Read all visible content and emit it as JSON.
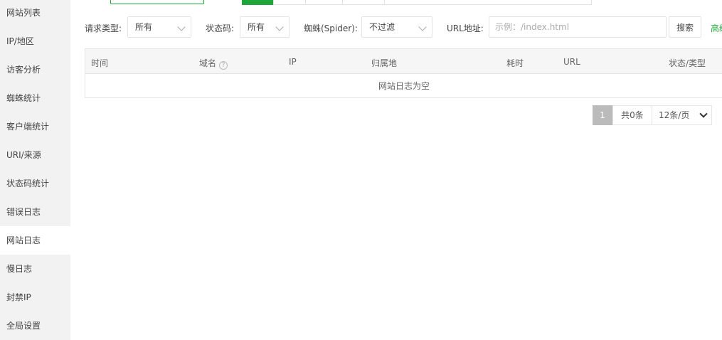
{
  "sidebar": {
    "items": [
      {
        "label": "网站列表"
      },
      {
        "label": "IP/地区"
      },
      {
        "label": "访客分析"
      },
      {
        "label": "蜘蛛统计"
      },
      {
        "label": "客户端统计"
      },
      {
        "label": "URI/来源"
      },
      {
        "label": "状态码统计"
      },
      {
        "label": "错误日志"
      },
      {
        "label": "网站日志",
        "active": true
      },
      {
        "label": "慢日志"
      },
      {
        "label": "封禁IP"
      },
      {
        "label": "全局设置"
      }
    ]
  },
  "filters": {
    "request_type_label": "请求类型:",
    "request_type_value": "所有",
    "status_code_label": "状态码:",
    "status_code_value": "所有",
    "spider_label": "蜘蛛(Spider):",
    "spider_value": "不过滤",
    "url_label": "URL地址:",
    "url_placeholder": "示例：/index.html",
    "search_label": "搜索",
    "advanced_label": "高级"
  },
  "table": {
    "columns": [
      "时间",
      "域名",
      "IP",
      "归属地",
      "耗时",
      "URL",
      "状态/类型"
    ],
    "empty_text": "网站日志为空"
  },
  "pagination": {
    "current_page": "1",
    "total_label": "共0条",
    "page_size_label": "12条/页"
  },
  "colors": {
    "accent": "#20a53a",
    "sidebar_bg": "#f2f2f2"
  }
}
